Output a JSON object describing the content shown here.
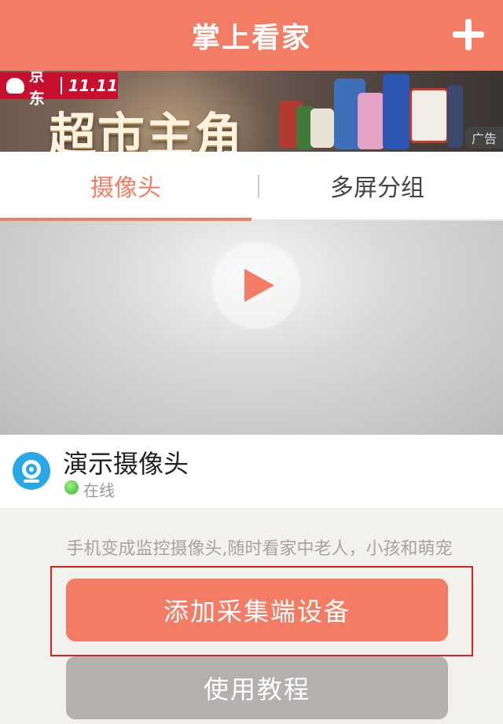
{
  "header": {
    "title": "掌上看家",
    "add_icon": "plus-icon"
  },
  "banner": {
    "brand": "京东",
    "sale": "11.11",
    "slogan": "超市主角",
    "ad_label": "广告"
  },
  "tabs": [
    {
      "label": "摄像头",
      "active": true
    },
    {
      "label": "多屏分组",
      "active": false
    }
  ],
  "video": {
    "play_icon": "play-icon"
  },
  "camera": {
    "name": "演示摄像头",
    "status": "在线",
    "icon": "webcam-icon"
  },
  "hint": "手机变成监控摄像头,随时看家中老人，小孩和萌宠",
  "buttons": {
    "add_device": "添加采集端设备",
    "tutorial": "使用教程"
  },
  "colors": {
    "accent": "#f37d64",
    "online": "#33b52a",
    "highlight": "#e02020"
  }
}
